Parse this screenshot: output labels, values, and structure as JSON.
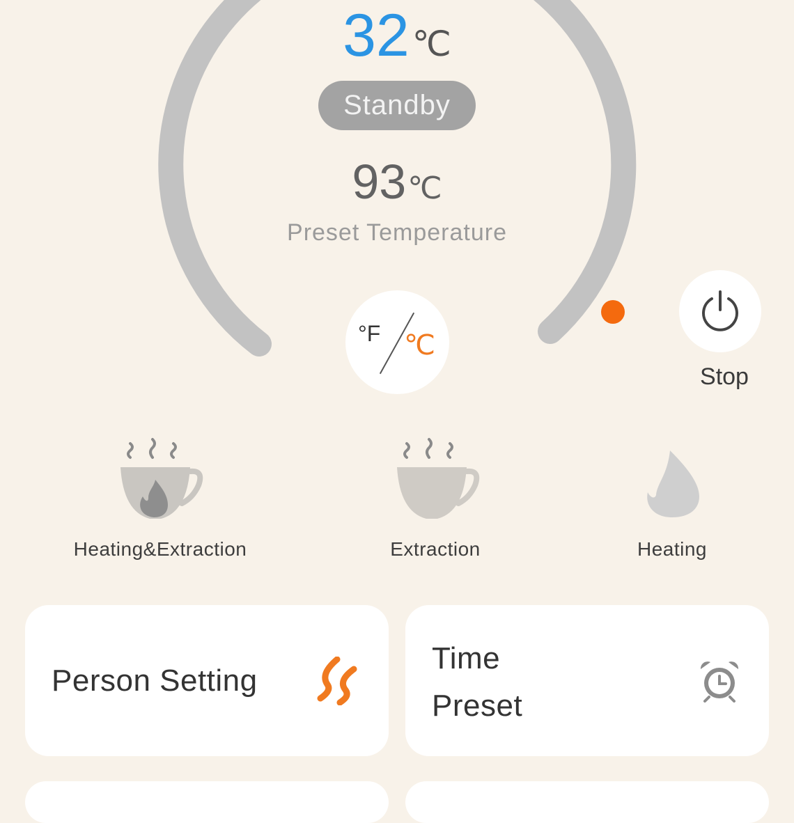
{
  "thermostat": {
    "current_temp": "32",
    "current_unit": "℃",
    "status": "Standby",
    "preset_temp": "93",
    "preset_unit": "℃",
    "preset_label": "Preset Temperature",
    "unit_toggle": {
      "fahrenheit": "°F",
      "celsius": "℃"
    },
    "stop_label": "Stop"
  },
  "modes": [
    {
      "label": "Heating&Extraction",
      "icon": "cup-with-flame-icon"
    },
    {
      "label": "Extraction",
      "icon": "cup-icon"
    },
    {
      "label": "Heating",
      "icon": "flame-icon"
    }
  ],
  "cards": [
    {
      "title": "Person Setting",
      "icon": "heat-waves-icon"
    },
    {
      "title_line1": "Time",
      "title_line2": "Preset",
      "icon": "alarm-clock-icon"
    }
  ],
  "colors": {
    "background": "#f8f2e9",
    "accent_blue": "#2b94e3",
    "accent_orange": "#f07a20",
    "dial_track": "#c2c2c2",
    "status_pill": "#a3a3a3"
  }
}
